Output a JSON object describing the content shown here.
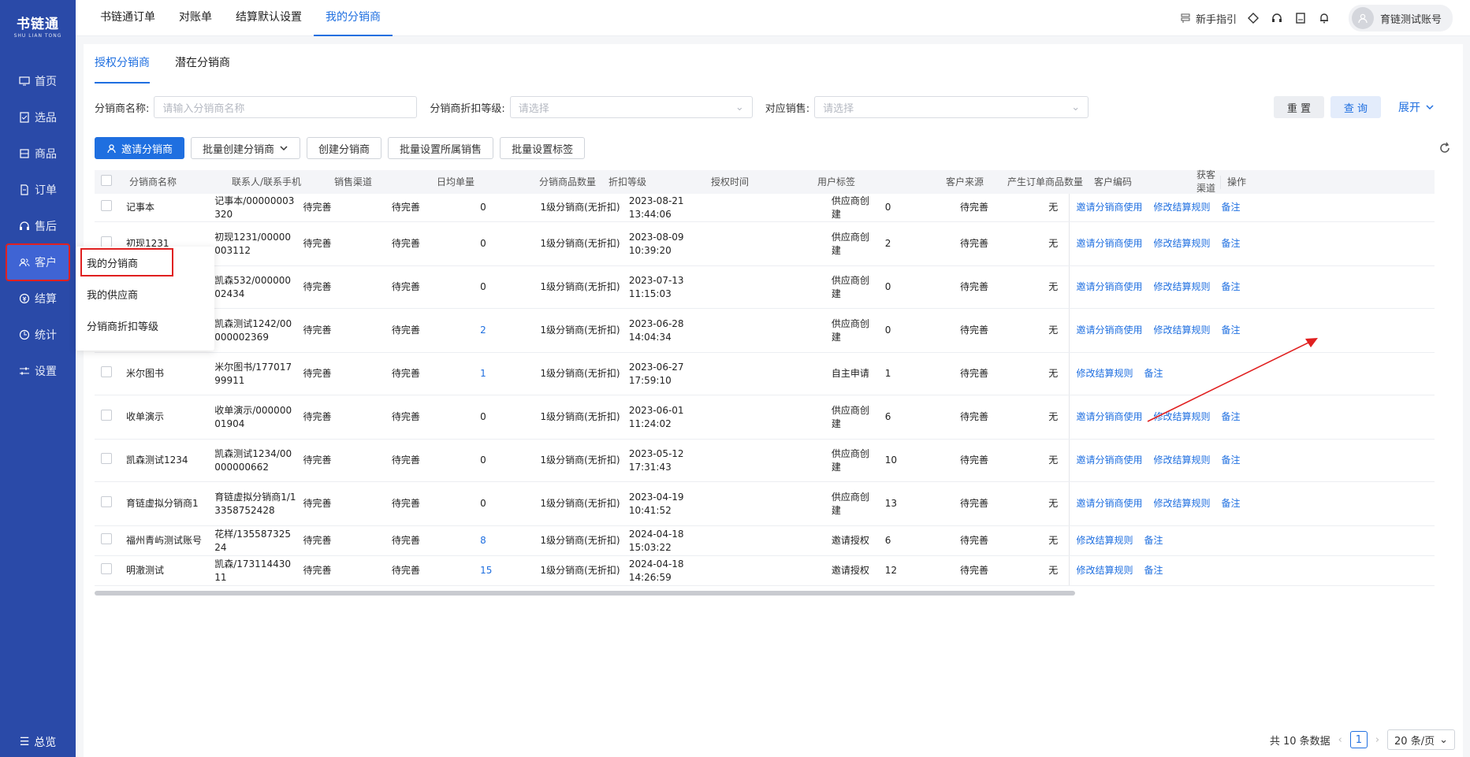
{
  "sidebar": {
    "logo_title": "书链通",
    "logo_sub": "SHU LIAN TONG",
    "items": [
      {
        "label": "首页",
        "icon": "monitor-icon"
      },
      {
        "label": "选品",
        "icon": "checklist-icon"
      },
      {
        "label": "商品",
        "icon": "box-icon"
      },
      {
        "label": "订单",
        "icon": "document-icon"
      },
      {
        "label": "售后",
        "icon": "headset-icon"
      },
      {
        "label": "客户",
        "icon": "user-group-icon"
      },
      {
        "label": "结算",
        "icon": "settle-icon"
      },
      {
        "label": "统计",
        "icon": "clock-chart-icon"
      },
      {
        "label": "设置",
        "icon": "sliders-icon"
      }
    ],
    "bottom": "总览"
  },
  "flyout": {
    "items": [
      "我的分销商",
      "我的供应商",
      "分销商折扣等级"
    ]
  },
  "topbar": {
    "tabs": [
      "书链通订单",
      "对账单",
      "结算默认设置",
      "我的分销商"
    ],
    "guide": "新手指引",
    "account": "育链测试账号"
  },
  "subtabs": [
    "授权分销商",
    "潜在分销商"
  ],
  "filters": {
    "name_label": "分销商名称:",
    "name_placeholder": "请输入分销商名称",
    "level_label": "分销商折扣等级:",
    "level_placeholder": "请选择",
    "sales_label": "对应销售:",
    "sales_placeholder": "请选择",
    "reset": "重 置",
    "query": "查 询",
    "expand": "展开"
  },
  "actions": {
    "invite": "邀请分销商",
    "batch_create": "批量创建分销商",
    "create": "创建分销商",
    "batch_sales": "批量设置所属销售",
    "batch_tags": "批量设置标签"
  },
  "table": {
    "headers": [
      "分销商名称",
      "联系人/联系手机",
      "销售渠道",
      "日均单量",
      "分销商品数量",
      "折扣等级",
      "授权时间",
      "用户标签",
      "客户来源",
      "产生订单商品数量",
      "客户编码",
      "获客渠道",
      "操作"
    ],
    "rows": [
      {
        "name": "记事本",
        "contact": "记事本/00000003320",
        "channel": "待完善",
        "daily": "待完善",
        "count": "0",
        "level": "1级分销商(无折扣)",
        "time": "2023-08-21 13:44:06",
        "source": "供应商创建",
        "orders": "0",
        "code": "待完善",
        "acq": "无",
        "ops": [
          "邀请分销商使用",
          "修改结算规则",
          "备注"
        ]
      },
      {
        "name": "初现1231",
        "contact": "初现1231/00000003112",
        "channel": "待完善",
        "daily": "待完善",
        "count": "0",
        "level": "1级分销商(无折扣)",
        "time": "2023-08-09 10:39:20",
        "source": "供应商创建",
        "orders": "2",
        "code": "待完善",
        "acq": "无",
        "ops": [
          "邀请分销商使用",
          "修改结算规则",
          "备注"
        ]
      },
      {
        "name": "",
        "contact": "凯森532/00000002434",
        "channel": "待完善",
        "daily": "待完善",
        "count": "0",
        "level": "1级分销商(无折扣)",
        "time": "2023-07-13 11:15:03",
        "source": "供应商创建",
        "orders": "0",
        "code": "待完善",
        "acq": "无",
        "ops": [
          "邀请分销商使用",
          "修改结算规则",
          "备注"
        ]
      },
      {
        "name": "",
        "contact": "凯森测试1242/00000002369",
        "channel": "待完善",
        "daily": "待完善",
        "count": "2",
        "level": "1级分销商(无折扣)",
        "time": "2023-06-28 14:04:34",
        "source": "供应商创建",
        "orders": "0",
        "code": "待完善",
        "acq": "无",
        "ops": [
          "邀请分销商使用",
          "修改结算规则",
          "备注"
        ]
      },
      {
        "name": "米尔图书",
        "contact": "米尔图书/17701799911",
        "channel": "待完善",
        "daily": "待完善",
        "count": "1",
        "level": "1级分销商(无折扣)",
        "time": "2023-06-27 17:59:10",
        "source": "自主申请",
        "orders": "1",
        "code": "待完善",
        "acq": "无",
        "ops": [
          "修改结算规则",
          "备注"
        ]
      },
      {
        "name": "收单演示",
        "contact": "收单演示/00000001904",
        "channel": "待完善",
        "daily": "待完善",
        "count": "0",
        "level": "1级分销商(无折扣)",
        "time": "2023-06-01 11:24:02",
        "source": "供应商创建",
        "orders": "6",
        "code": "待完善",
        "acq": "无",
        "ops": [
          "邀请分销商使用",
          "修改结算规则",
          "备注"
        ]
      },
      {
        "name": "凯森测试1234",
        "contact": "凯森测试1234/00000000662",
        "channel": "待完善",
        "daily": "待完善",
        "count": "0",
        "level": "1级分销商(无折扣)",
        "time": "2023-05-12 17:31:43",
        "source": "供应商创建",
        "orders": "10",
        "code": "待完善",
        "acq": "无",
        "ops": [
          "邀请分销商使用",
          "修改结算规则",
          "备注"
        ]
      },
      {
        "name": "育链虚拟分销商1",
        "contact": "育链虚拟分销商1/13358752428",
        "channel": "待完善",
        "daily": "待完善",
        "count": "0",
        "level": "1级分销商(无折扣)",
        "time": "2023-04-19 10:41:52",
        "source": "供应商创建",
        "orders": "13",
        "code": "待完善",
        "acq": "无",
        "ops": [
          "邀请分销商使用",
          "修改结算规则",
          "备注"
        ]
      },
      {
        "name": "福州青屿测试账号",
        "contact": "花样/13558732524",
        "channel": "待完善",
        "daily": "待完善",
        "count": "8",
        "level": "1级分销商(无折扣)",
        "time": "2024-04-18 15:03:22",
        "source": "邀请授权",
        "orders": "6",
        "code": "待完善",
        "acq": "无",
        "ops": [
          "修改结算规则",
          "备注"
        ]
      },
      {
        "name": "明澈测试",
        "contact": "凯森/17311443011",
        "channel": "待完善",
        "daily": "待完善",
        "count": "15",
        "level": "1级分销商(无折扣)",
        "time": "2024-04-18 14:26:59",
        "source": "邀请授权",
        "orders": "12",
        "code": "待完善",
        "acq": "无",
        "ops": [
          "修改结算规则",
          "备注"
        ]
      }
    ]
  },
  "pagination": {
    "total": "共 10 条数据",
    "page": "1",
    "size": "20 条/页"
  },
  "colors": {
    "sidebar": "#2a4aa8",
    "accent": "#1f6fe0",
    "highlight": "#e02020"
  }
}
